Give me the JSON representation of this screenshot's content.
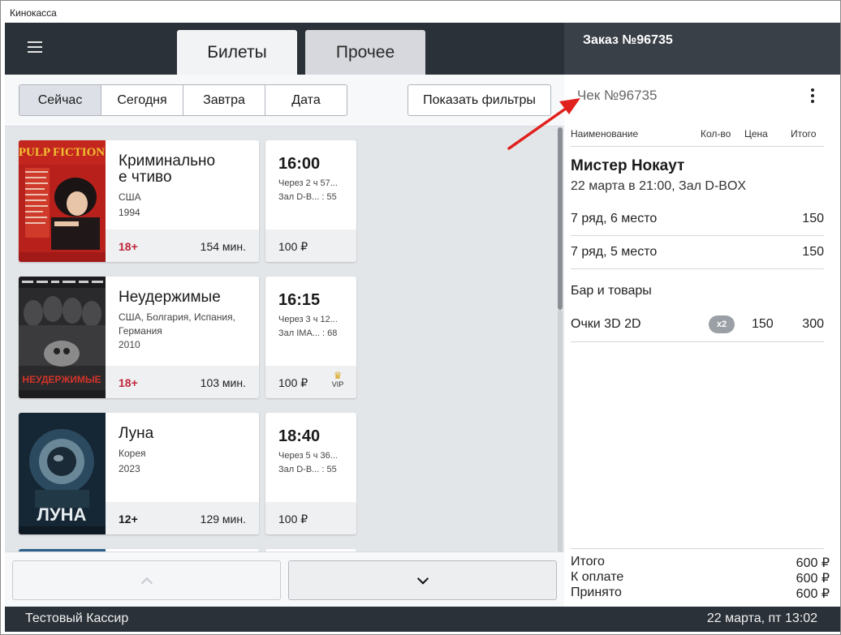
{
  "window": {
    "title": "Кинокасса"
  },
  "header": {
    "tabs": [
      {
        "label": "Билеты",
        "active": true
      },
      {
        "label": "Прочее",
        "active": false
      }
    ],
    "order_title": "Заказ №96735"
  },
  "filters": {
    "segments": [
      "Сейчас",
      "Сегодня",
      "Завтра",
      "Дата"
    ],
    "active_segment": "Сейчас",
    "show_filters_label": "Показать фильтры"
  },
  "movies": [
    {
      "title": "Криминальное чтиво",
      "title_line1": "Криминально",
      "title_line2": "е чтиво",
      "countries": "США",
      "year": "1994",
      "age": "18+",
      "duration": "154 мин.",
      "poster_text": "PULP FICTION",
      "session": {
        "time": "16:00",
        "starts_in": "Через 2 ч 57...",
        "hall": "Зал D-B... : 55",
        "price": "100 ₽",
        "vip": false
      }
    },
    {
      "title": "Неудержимые",
      "countries": "США, Болгария, Испания, Германия",
      "year": "2010",
      "age": "18+",
      "duration": "103 мин.",
      "poster_text": "НЕУДЕРЖИМЫЕ",
      "session": {
        "time": "16:15",
        "starts_in": "Через 3 ч 12...",
        "hall": "Зал IMA... : 68",
        "price": "100 ₽",
        "vip": true,
        "vip_label": "VIP"
      }
    },
    {
      "title": "Луна",
      "countries": "Корея",
      "year": "2023",
      "age": "12+",
      "duration": "129 мин.",
      "poster_text": "ЛУНА",
      "session": {
        "time": "18:40",
        "starts_in": "Через 5 ч 36...",
        "hall": "Зал D-B... : 55",
        "price": "100 ₽",
        "vip": false
      }
    }
  ],
  "receipt": {
    "number": "Чек №96735",
    "columns": {
      "name": "Наименование",
      "qty": "Кол-во",
      "price": "Цена",
      "total": "Итого"
    },
    "ticket_item": {
      "title": "Мистер Нокаут",
      "subtitle": "22 марта в 21:00, Зал D-BOX",
      "seats": [
        {
          "label": "7 ряд, 6 место",
          "price": "150"
        },
        {
          "label": "7 ряд, 5 место",
          "price": "150"
        }
      ]
    },
    "goods_section": {
      "title": "Бар и товары",
      "items": [
        {
          "name": "Очки 3D 2D",
          "qty": "x2",
          "price": "150",
          "total": "300"
        }
      ]
    },
    "totals": [
      {
        "label": "Итого",
        "value": "600 ₽"
      },
      {
        "label": "К оплате",
        "value": "600 ₽"
      },
      {
        "label": "Принято",
        "value": "600 ₽"
      }
    ]
  },
  "status": {
    "cashier": "Тестовый Кассир",
    "datetime": "22 марта, пт  13:02"
  },
  "colors": {
    "header_bg": "#2b3138",
    "age_red": "#c0263a",
    "annotation_arrow": "#e0201c"
  }
}
